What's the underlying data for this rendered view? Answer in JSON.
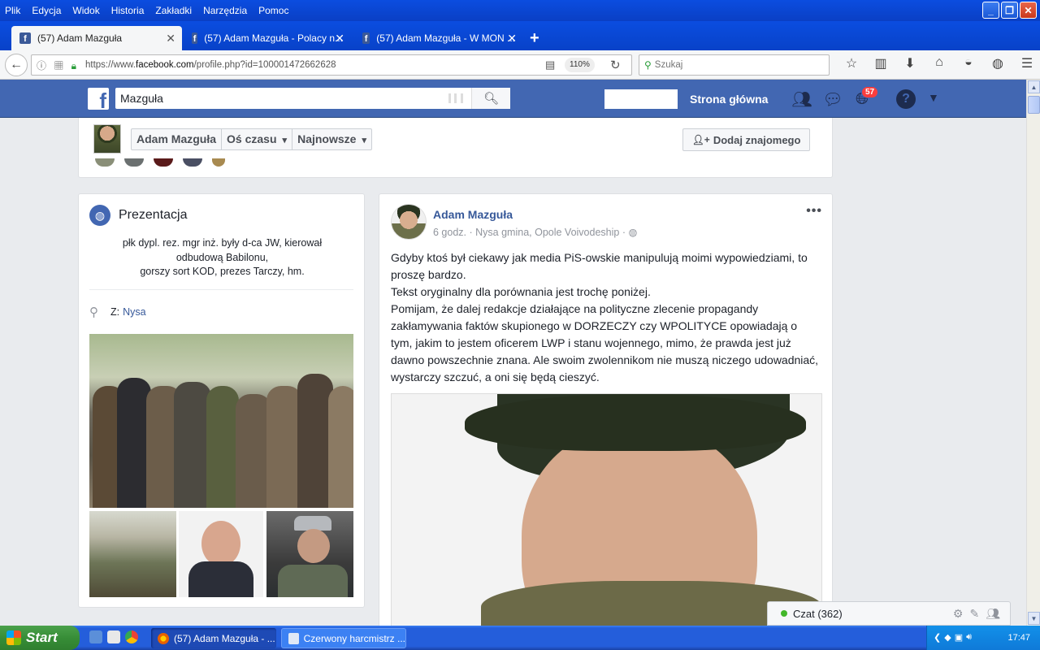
{
  "browser": {
    "menu": [
      "Plik",
      "Edycja",
      "Widok",
      "Historia",
      "Zakładki",
      "Narzędzia",
      "Pomoc"
    ],
    "tabs": [
      {
        "label": "(57) Adam Mazguła",
        "active": true
      },
      {
        "label": "(57) Adam Mazguła - Polacy n...",
        "active": false
      },
      {
        "label": "(57) Adam Mazguła - W MON ...",
        "active": false
      }
    ],
    "url_prefix": "https://www.",
    "url_domain": "facebook.com",
    "url_path": "/profile.php?id=100001472662628",
    "zoom": "110%",
    "search_placeholder": "Szukaj"
  },
  "fb": {
    "search_value": "Mazguła",
    "home_label": "Strona główna",
    "notification_count": "57",
    "profile": {
      "name": "Adam Mazguła",
      "nav": [
        "Adam Mazguła",
        "Oś czasu",
        "Najnowsze"
      ],
      "add_friend": "Dodaj znajomego"
    },
    "intro": {
      "title": "Prezentacja",
      "bio_lines": [
        "płk dypl. rez. mgr inż. były d-ca JW, kierował",
        "odbudową Babilonu,",
        "gorszy sort KOD, prezes Tarczy, hm."
      ],
      "location_prefix": "Z:",
      "location": "Nysa"
    },
    "post": {
      "author": "Adam Mazguła",
      "time": "6 godz.",
      "place": "Nysa gmina, Opole Voivodeship",
      "meta_sep": "·",
      "paragraphs": [
        "Gdyby ktoś był ciekawy jak media PiS-owskie manipulują moimi wypowiedziami, to proszę bardzo.",
        "Tekst oryginalny dla porównania jest trochę poniżej.",
        "Pomijam, że dalej redakcje działające na polityczne zlecenie propagandy zakłamywania faktów skupionego w DORZECZY czy WPOLITYCE opowiadają o tym, jakim to jestem oficerem LWP i stanu wojennego, mimo, że prawda jest już dawno powszechnie znana. Ale swoim zwolennikom nie muszą niczego udowadniać, wystarczy szczuć, a oni się będą cieszyć."
      ]
    },
    "chat": {
      "label": "Czat (362)"
    }
  },
  "taskbar": {
    "start": "Start",
    "tasks": [
      "(57) Adam Mazguła - ...",
      "Czerwony harcmistrz ..."
    ],
    "clock": "17:47"
  }
}
